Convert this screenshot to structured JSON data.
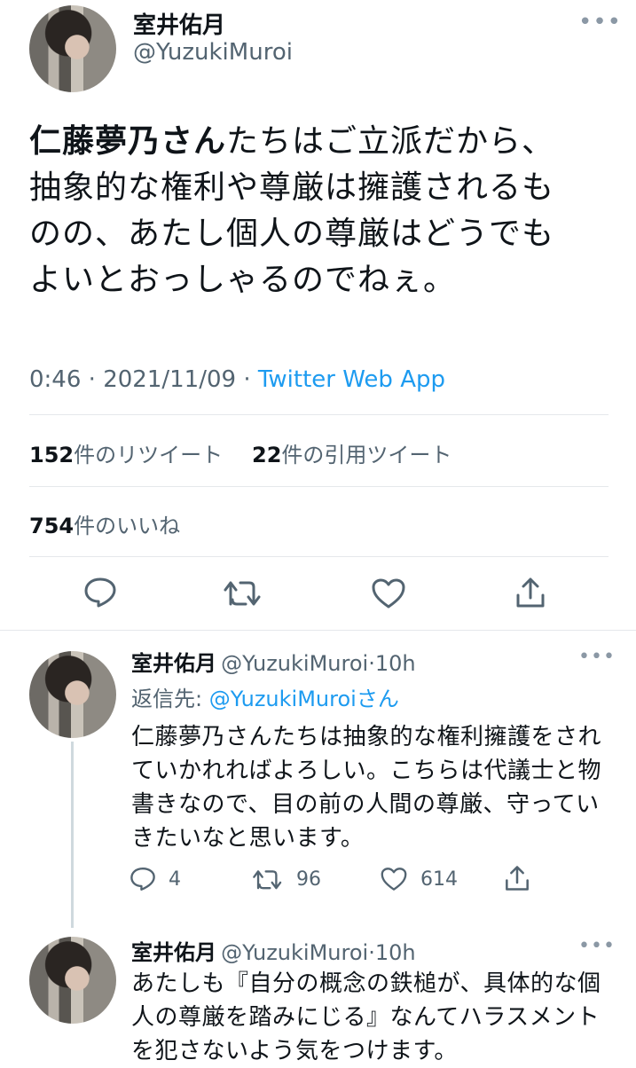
{
  "main_tweet": {
    "author_name": "室井佑月",
    "author_handle": "@YuzukiMuroi",
    "text_bold": "仁藤夢乃さん",
    "text_line1_rest": "たちはご立派だから、",
    "text_line2": "抽象的な権利や尊厳は擁護されるも",
    "text_line3": "のの、あたし個人の尊厳はどうでも",
    "text_line4": "よいとおっしゃるのでねぇ。",
    "time": "0:46",
    "date": "2021/11/09",
    "app": "Twitter Web App",
    "retweets_count": "152",
    "retweets_label": "件のリツイート",
    "quotes_count": "22",
    "quotes_label": "件の引用ツイート",
    "likes_count": "754",
    "likes_label": "件のいいね"
  },
  "replies": [
    {
      "author_name": "室井佑月",
      "author_handle": "@YuzukiMuroi",
      "time_ago": "10h",
      "reply_to_label": "返信先: ",
      "reply_to_handle": "@YuzukiMuroi",
      "reply_to_suffix": "さん",
      "line1": "仁藤夢乃さんたちは抽象的な権利擁護をされ",
      "line2": "ていかれればよろしい。こちらは代議士と物",
      "line3": "書きなので、目の前の人間の尊厳、守ってい",
      "line4": "きたいなと思います。",
      "reply_count": "4",
      "retweet_count": "96",
      "like_count": "614"
    },
    {
      "author_name": "室井佑月",
      "author_handle": "@YuzukiMuroi",
      "time_ago": "10h",
      "line1": "あたしも『自分の概念の鉄槌が、具体的な個",
      "line2": "人の尊厳を踏みにじる』なんてハラスメント",
      "line3": "を犯さないよう気をつけます。"
    }
  ],
  "ui": {
    "separator": "·",
    "more": "•••"
  },
  "icons": [
    "reply-icon",
    "retweet-icon",
    "like-icon",
    "share-icon",
    "more-icon"
  ],
  "colors": {
    "link": "#1d9bf0",
    "secondary": "#536471",
    "border": "#e5e8eb"
  }
}
